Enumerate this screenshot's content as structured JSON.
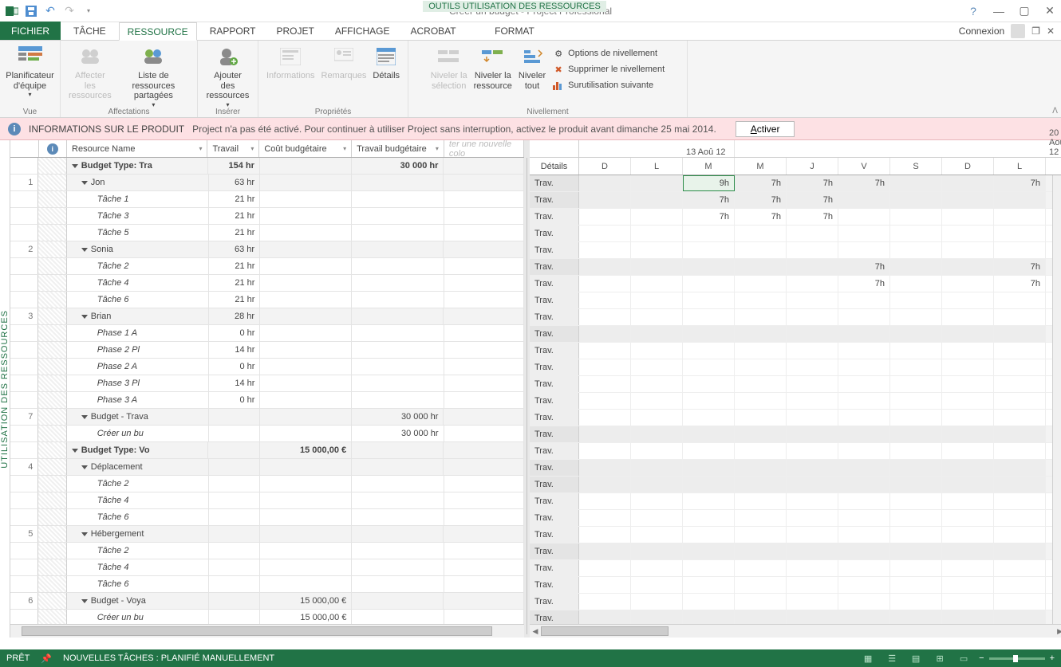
{
  "title": "Créer un budget - Project Professional",
  "context_tools": "OUTILS UTILISATION DES RESSOURCES",
  "tabs": {
    "file": "FICHIER",
    "tache": "TÂCHE",
    "ressource": "RESSOURCE",
    "rapport": "RAPPORT",
    "projet": "PROJET",
    "affichage": "AFFICHAGE",
    "acrobat": "ACROBAT",
    "format": "FORMAT"
  },
  "signin": "Connexion",
  "ribbon": {
    "group_vue": "Vue",
    "group_aff": "Affectations",
    "group_ins": "Insérer",
    "group_prop": "Propriétés",
    "group_niv": "Nivellement",
    "planificateur": "Planificateur\nd'équipe",
    "affecter": "Affecter les\nressources",
    "liste": "Liste de ressources\npartagées",
    "ajouter": "Ajouter des\nressources",
    "informations": "Informations",
    "remarques": "Remarques",
    "details_btn": "Détails",
    "niv_sel": "Niveler la\nsélection",
    "niv_res": "Niveler la\nressource",
    "niv_tout": "Niveler\ntout",
    "opt_niv": "Options de nivellement",
    "supp_niv": "Supprimer le nivellement",
    "surut": "Surutilisation suivante"
  },
  "notice": {
    "title": "INFORMATIONS SUR LE PRODUIT",
    "msg": "Project n'a pas été activé. Pour continuer à utiliser Project sans interruption, activez le produit avant dimanche 25 mai 2014.",
    "btn": "Activer"
  },
  "vert": "UTILISATION DES RESSOURCES",
  "cols": {
    "name": "Resource Name",
    "work": "Travail",
    "budcost": "Coût budgétaire",
    "budwork": "Travail budgétaire",
    "new": "ter une nouvelle colo"
  },
  "timescale": {
    "date1": "13 Aoû 12",
    "date2": "20 Aoû 12",
    "days": [
      "D",
      "L",
      "M",
      "M",
      "J",
      "V",
      "S",
      "D",
      "L"
    ],
    "details": "Détails",
    "trav": "Trav."
  },
  "rows": [
    {
      "rn": "",
      "grey": true,
      "bold": true,
      "ind": 0,
      "tri": true,
      "name": "Budget Type: Tra",
      "work": "154 hr",
      "budc": "",
      "budw": "30 000 hr",
      "vals": [
        "",
        "",
        "9h",
        "7h",
        "7h",
        "7h",
        "",
        "",
        "7h"
      ],
      "sel": 2
    },
    {
      "rn": "1",
      "grey": true,
      "ind": 1,
      "tri": true,
      "name": "Jon",
      "work": "63 hr",
      "vals": [
        "",
        "",
        "7h",
        "7h",
        "7h",
        "",
        "",
        "",
        ""
      ]
    },
    {
      "rn": "",
      "ind": 2,
      "name": "Tâche 1",
      "work": "21 hr",
      "vals": [
        "",
        "",
        "7h",
        "7h",
        "7h",
        "",
        "",
        "",
        ""
      ]
    },
    {
      "rn": "",
      "ind": 2,
      "name": "Tâche 3",
      "work": "21 hr"
    },
    {
      "rn": "",
      "ind": 2,
      "name": "Tâche 5",
      "work": "21 hr"
    },
    {
      "rn": "2",
      "grey": true,
      "ind": 1,
      "tri": true,
      "name": "Sonia",
      "work": "63 hr",
      "vals": [
        "",
        "",
        "",
        "",
        "",
        "7h",
        "",
        "",
        "7h"
      ]
    },
    {
      "rn": "",
      "ind": 2,
      "name": "Tâche 2",
      "work": "21 hr",
      "vals": [
        "",
        "",
        "",
        "",
        "",
        "7h",
        "",
        "",
        "7h"
      ]
    },
    {
      "rn": "",
      "ind": 2,
      "name": "Tâche 4",
      "work": "21 hr"
    },
    {
      "rn": "",
      "ind": 2,
      "name": "Tâche 6",
      "work": "21 hr"
    },
    {
      "rn": "3",
      "grey": true,
      "ind": 1,
      "tri": true,
      "name": "Brian",
      "work": "28 hr"
    },
    {
      "rn": "",
      "ind": 2,
      "name": "Phase 1 A",
      "work": "0 hr"
    },
    {
      "rn": "",
      "ind": 2,
      "name": "Phase 2 Pl",
      "work": "14 hr"
    },
    {
      "rn": "",
      "ind": 2,
      "name": "Phase 2 A",
      "work": "0 hr"
    },
    {
      "rn": "",
      "ind": 2,
      "name": "Phase 3 Pl",
      "work": "14 hr"
    },
    {
      "rn": "",
      "ind": 2,
      "name": "Phase 3 A",
      "work": "0 hr"
    },
    {
      "rn": "7",
      "grey": true,
      "ind": 1,
      "tri": true,
      "name": "Budget - Trava",
      "budw": "30 000 hr"
    },
    {
      "rn": "",
      "ind": 2,
      "name": "Créer un bu",
      "budw": "30 000 hr"
    },
    {
      "rn": "",
      "grey": true,
      "bold": true,
      "ind": 0,
      "tri": true,
      "name": "Budget Type: Vo",
      "budc": "15 000,00 €"
    },
    {
      "rn": "4",
      "grey": true,
      "ind": 1,
      "tri": true,
      "name": "Déplacement"
    },
    {
      "rn": "",
      "ind": 2,
      "name": "Tâche 2"
    },
    {
      "rn": "",
      "ind": 2,
      "name": "Tâche 4"
    },
    {
      "rn": "",
      "ind": 2,
      "name": "Tâche 6"
    },
    {
      "rn": "5",
      "grey": true,
      "ind": 1,
      "tri": true,
      "name": "Hébergement"
    },
    {
      "rn": "",
      "ind": 2,
      "name": "Tâche 2"
    },
    {
      "rn": "",
      "ind": 2,
      "name": "Tâche 4"
    },
    {
      "rn": "",
      "ind": 2,
      "name": "Tâche 6"
    },
    {
      "rn": "6",
      "grey": true,
      "ind": 1,
      "tri": true,
      "name": "Budget - Voya",
      "budc": "15 000,00 €"
    },
    {
      "rn": "",
      "ind": 2,
      "name": "Créer un bu",
      "budc": "15 000,00 €"
    }
  ],
  "status": {
    "ready": "PRÊT",
    "mode": "NOUVELLES TÂCHES : PLANIFIÉ MANUELLEMENT"
  }
}
